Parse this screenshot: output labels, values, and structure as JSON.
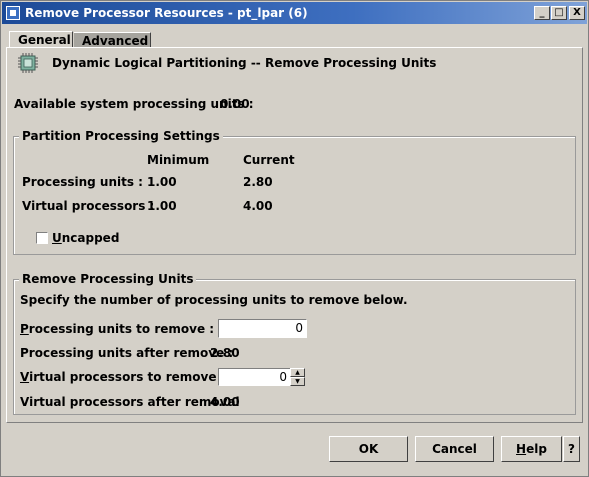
{
  "window": {
    "title": "Remove Processor Resources  - pt_lpar (6)"
  },
  "titlebar_buttons": {
    "minimize": "_",
    "maximize": "□",
    "close": "X"
  },
  "tabs": [
    {
      "label": "General"
    },
    {
      "label": "Advanced"
    }
  ],
  "header": {
    "title": "Dynamic Logical Partitioning -- Remove Processing Units"
  },
  "available": {
    "label": "Available system processing units :",
    "value": "0.00"
  },
  "partition_settings": {
    "legend": "Partition Processing Settings",
    "col_min": "Minimum",
    "col_current": "Current",
    "rows": [
      {
        "label": "Processing units :",
        "min": "1.00",
        "current": "2.80"
      },
      {
        "label": "Virtual processors :",
        "min": "1.00",
        "current": "4.00"
      }
    ],
    "uncapped_label_u": "U",
    "uncapped_label_rest": "ncapped",
    "uncapped_checked": false
  },
  "remove_units": {
    "legend": "Remove Processing Units",
    "instruction": "Specify the number of processing units to remove below.",
    "pu_remove_label_u": "P",
    "pu_remove_label_rest": "rocessing units to remove :",
    "pu_remove_value": "0",
    "pu_after_label": "Processing units after remove :",
    "pu_after_value": "2.80",
    "vp_remove_label_u": "V",
    "vp_remove_label_rest": "irtual processors to remove :",
    "vp_remove_value": "0",
    "vp_after_label": "Virtual processors after removal",
    "vp_after_value": "4.00"
  },
  "buttons": {
    "ok": "OK",
    "cancel": "Cancel",
    "help_u": "H",
    "help_rest": "elp",
    "question": "?"
  },
  "icons": {
    "header": "processor-chip-icon",
    "spin_up": "▲",
    "spin_down": "▼"
  }
}
